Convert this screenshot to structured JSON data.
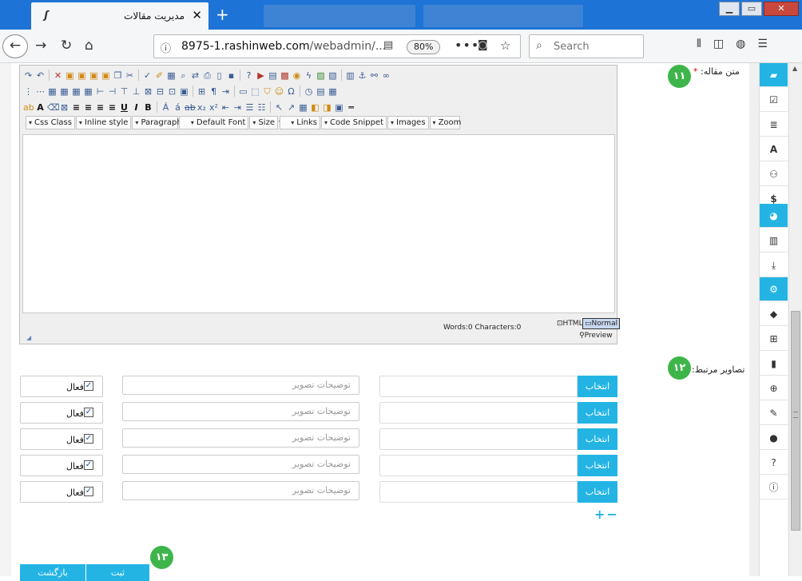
{
  "browser": {
    "tab_title": "مدیریت مقالات",
    "tab_close": "✕",
    "new_tab": "+",
    "url_host": "8975-1.rashinweb.com",
    "url_path": "/webadmin/...",
    "zoom": "80%",
    "search_placeholder": "Search",
    "window_minimize": "▁",
    "window_maximize": "▭",
    "window_close": "✕"
  },
  "editor": {
    "label": "متن مقاله:",
    "required_mark": "*",
    "step": "۱۱",
    "dropdowns": [
      "Css Class",
      "Inline style",
      "Paragraph",
      "Default Font",
      "Size",
      "",
      "Links",
      "Code Snippet",
      "Images",
      "Zoom"
    ],
    "word_count": "Words:0 Characters:0",
    "mode_html": "HTML",
    "mode_normal": "Normal",
    "mode_preview": "Preview"
  },
  "images": {
    "label": "تصاویر مرتبط:",
    "step": "۱۲",
    "active_label": "فعال",
    "desc_placeholder": "توضیحات تصویر",
    "select_label": "انتخاب",
    "rows": [
      1,
      2,
      3,
      4,
      5
    ],
    "add": "+",
    "remove": "−"
  },
  "actions": {
    "step": "۱۳",
    "submit": "ثبت",
    "back": "بازگشت"
  },
  "colors": {
    "accent": "#23b4e4",
    "step_badge": "#3db54a",
    "titlebar": "#1d73d6"
  }
}
